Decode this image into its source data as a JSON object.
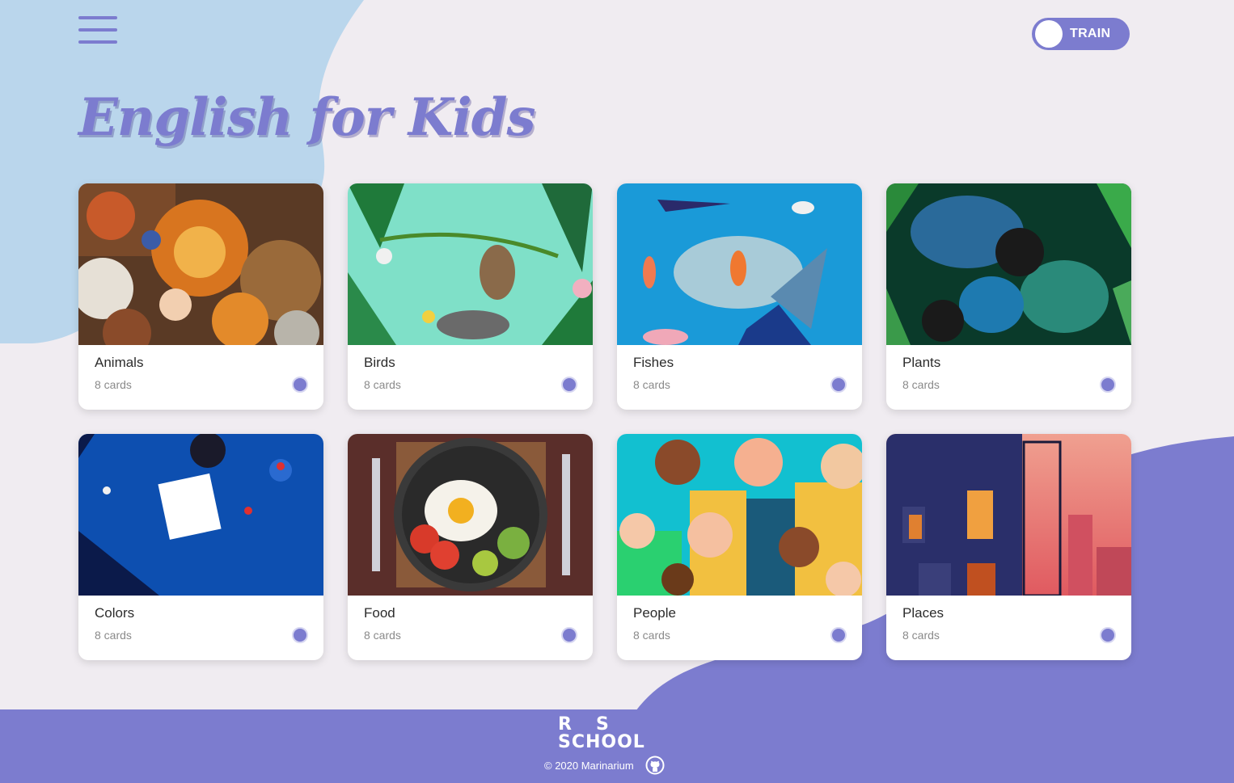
{
  "header": {
    "menu_icon": "hamburger-menu-icon",
    "mode_toggle": {
      "label": "TRAIN",
      "state": "train"
    }
  },
  "main": {
    "title": "English for Kids",
    "categories": [
      {
        "name": "Animals",
        "count": "8 cards"
      },
      {
        "name": "Birds",
        "count": "8 cards"
      },
      {
        "name": "Fishes",
        "count": "8 cards"
      },
      {
        "name": "Plants",
        "count": "8 cards"
      },
      {
        "name": "Colors",
        "count": "8 cards"
      },
      {
        "name": "Food",
        "count": "8 cards"
      },
      {
        "name": "People",
        "count": "8 cards"
      },
      {
        "name": "Places",
        "count": "8 cards"
      }
    ]
  },
  "footer": {
    "logo_rs": "RS",
    "logo_school": "SCHOOL",
    "copyright": "© 2020 Marinarium",
    "github_icon": "github-icon"
  },
  "colors": {
    "accent": "#7c7ccf",
    "background": "#f0ecf1",
    "blob_blue": "#bad6ec"
  }
}
